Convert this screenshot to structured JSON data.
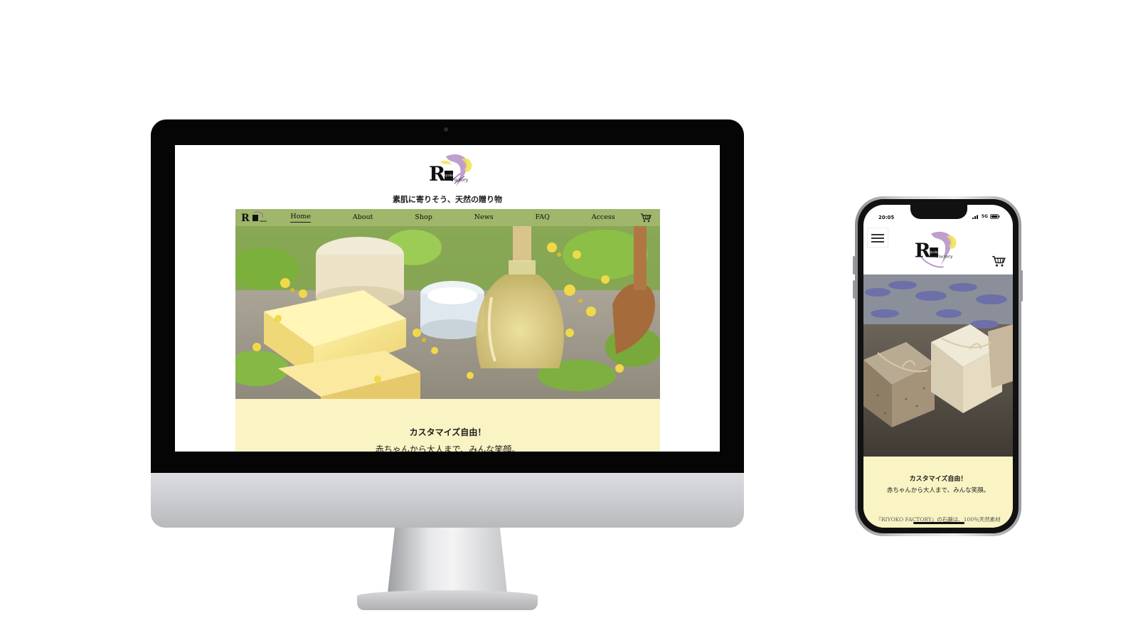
{
  "brand": {
    "logo_initial": "R",
    "logo_word_top": "iyoko",
    "logo_word_bottom": "Factory",
    "accent": "#9fb66b",
    "cream": "#faf3c3",
    "purple": "#9b6bb3",
    "yellow": "#f2e24f"
  },
  "desktop": {
    "tagline": "素肌に寄りそう、天然の贈り物",
    "nav": {
      "items": [
        {
          "label": "Home",
          "active": true
        },
        {
          "label": "About"
        },
        {
          "label": "Shop"
        },
        {
          "label": "News"
        },
        {
          "label": "FAQ"
        },
        {
          "label": "Access"
        }
      ],
      "cart_icon": "cart-icon"
    },
    "copy_line1": "カスタマイズ自由！",
    "copy_line2": "赤ちゃんから大人まで、みんな笑顔。"
  },
  "mobile": {
    "status_time": "20:05",
    "status_network": "5G",
    "menu_icon": "hamburger-menu-icon",
    "cart_icon": "cart-icon",
    "copy_line1": "カスタマイズ自由！",
    "copy_line2": "赤ちゃんから大人まで、みんな笑顔。",
    "copy_line3": "『RIYOKO FACTORY』の石鹸は、100％天然素材"
  }
}
